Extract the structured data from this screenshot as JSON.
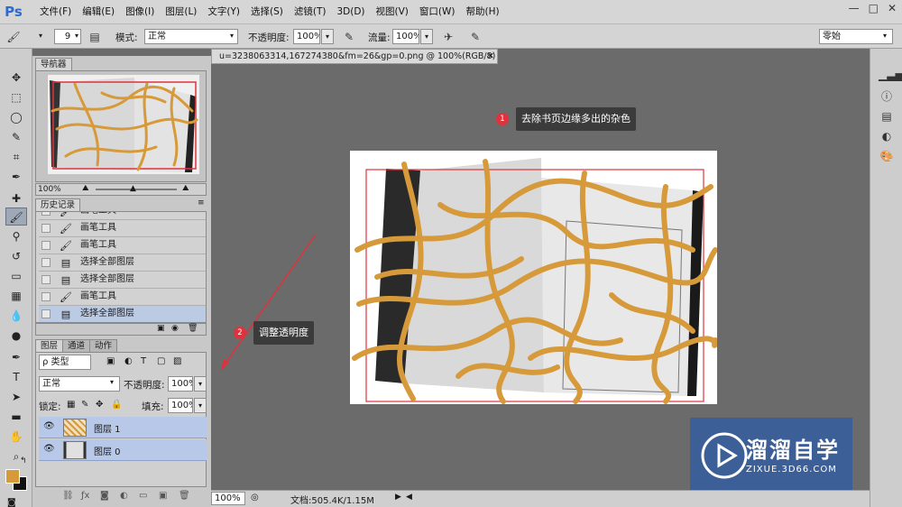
{
  "app": {
    "logo": "Ps"
  },
  "menu": [
    "文件(F)",
    "编辑(E)",
    "图像(I)",
    "图层(L)",
    "文字(Y)",
    "选择(S)",
    "滤镜(T)",
    "3D(D)",
    "视图(V)",
    "窗口(W)",
    "帮助(H)"
  ],
  "window_controls": [
    "—",
    "□",
    "✕"
  ],
  "options": {
    "brush_size": "9",
    "mode_label": "模式:",
    "mode_value": "正常",
    "opacity_label": "不透明度:",
    "opacity_value": "100%",
    "flow_label": "流量:",
    "flow_value": "100%",
    "workspace": "零始"
  },
  "navigator": {
    "title": "导航器",
    "zoom": "100%"
  },
  "history": {
    "title": "历史记录",
    "items": [
      {
        "label": "画笔工具",
        "icon": "brush-icon",
        "selected": false
      },
      {
        "label": "画笔工具",
        "icon": "brush-icon",
        "selected": false
      },
      {
        "label": "画笔工具",
        "icon": "brush-icon",
        "selected": false
      },
      {
        "label": "选择全部图层",
        "icon": "document-icon",
        "selected": false
      },
      {
        "label": "选择全部图层",
        "icon": "document-icon",
        "selected": false
      },
      {
        "label": "画笔工具",
        "icon": "brush-icon",
        "selected": false
      },
      {
        "label": "选择全部图层",
        "icon": "document-icon",
        "selected": true
      }
    ]
  },
  "layers": {
    "tabs": [
      "图层",
      "通道",
      "动作"
    ],
    "filter_label": "ρ 类型",
    "blend_mode": "正常",
    "opacity_label": "不透明度:",
    "opacity_value": "100%",
    "lock_label": "锁定:",
    "fill_label": "填充:",
    "fill_value": "100%",
    "items": [
      {
        "name": "图层 1"
      },
      {
        "name": "图层 0"
      }
    ]
  },
  "document": {
    "tab_title": "u=3238063314,167274380&fm=26&gp=0.png @ 100%(RGB/8) *",
    "tab_close": "✕",
    "zoom": "100%",
    "doc_info": "文档:505.4K/1.15M"
  },
  "annotations": [
    {
      "num": "1",
      "text": "去除书页边缘多出的杂色"
    },
    {
      "num": "2",
      "text": "调整透明度"
    }
  ],
  "watermark": {
    "brand": "溜溜自学",
    "url": "ZIXUE.3D66.COM"
  },
  "colors": {
    "accent_orange": "#d69a3a",
    "annotation_red": "#e0323c",
    "brand_blue": "#3d5f98",
    "foreground_swatch": "#d69a3a",
    "background_swatch": "#111111"
  }
}
